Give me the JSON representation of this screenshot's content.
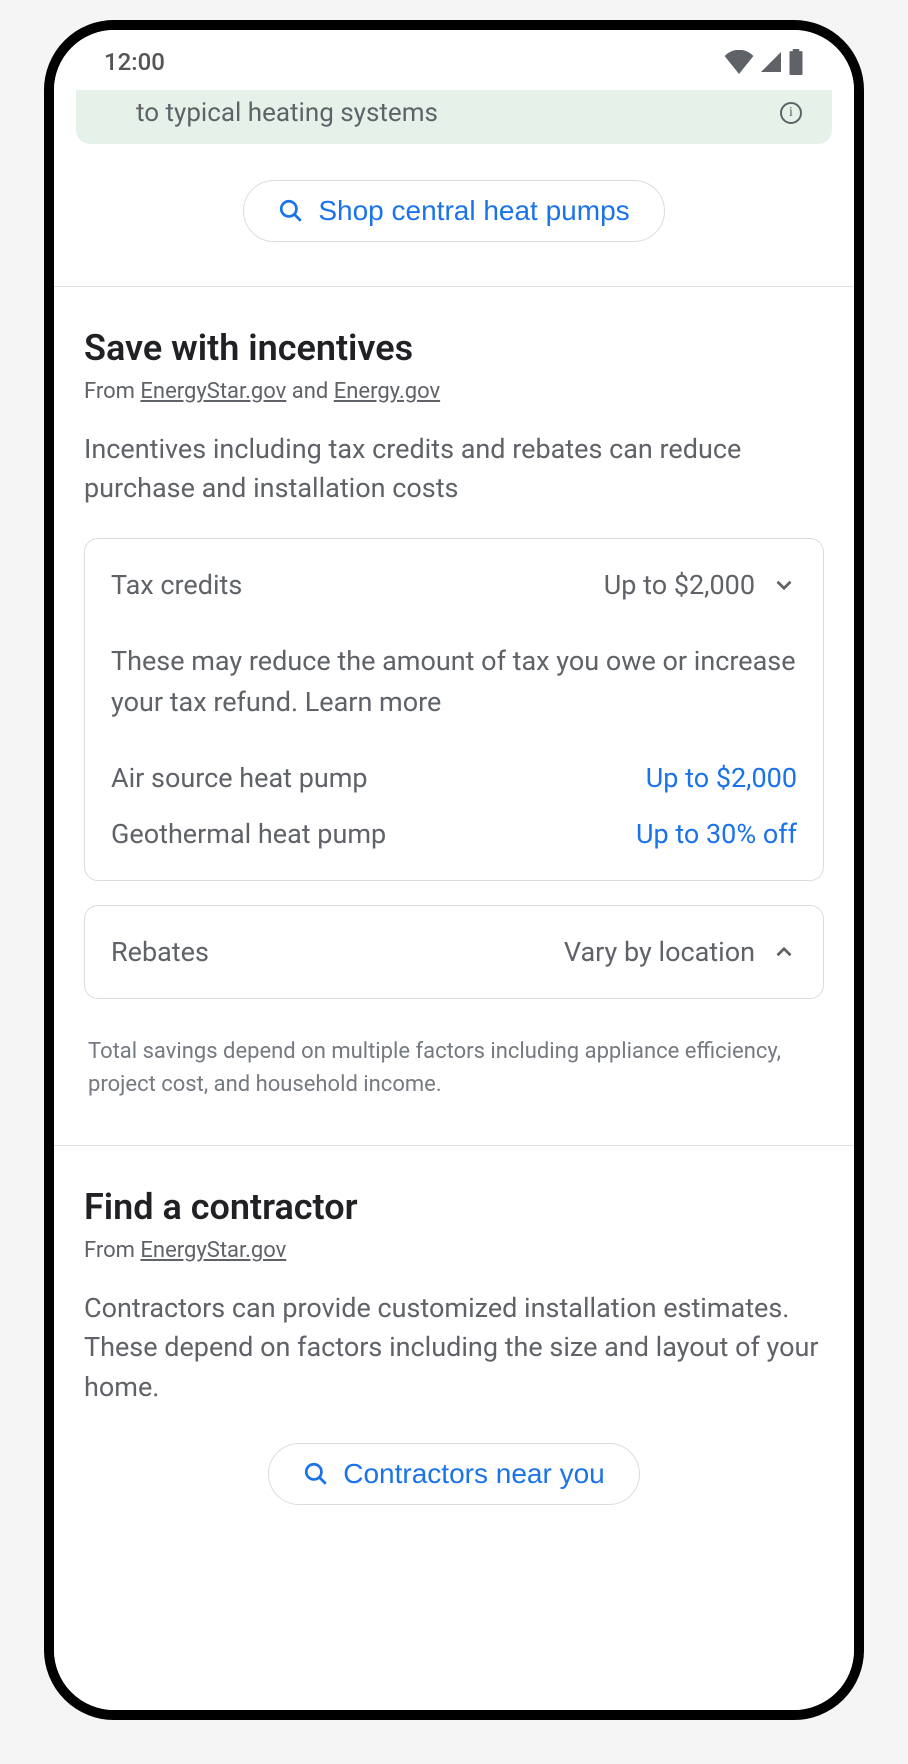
{
  "status": {
    "time": "12:00"
  },
  "banner": {
    "text": "to typical heating systems"
  },
  "shop_button": {
    "label": "Shop central heat pumps"
  },
  "incentives": {
    "heading": "Save with incentives",
    "from_prefix": "From ",
    "source1": "EnergyStar.gov",
    "and": " and ",
    "source2": "Energy.gov",
    "description": "Incentives including tax credits and rebates can reduce purchase and installation costs",
    "tax_credits": {
      "label": "Tax credits",
      "value": "Up to $2,000",
      "explain": "These may reduce the amount of tax you owe or increase your tax refund. Learn more",
      "items": [
        {
          "label": "Air source heat pump",
          "value": "Up to $2,000"
        },
        {
          "label": "Geothermal heat pump",
          "value": "Up to 30% off"
        }
      ]
    },
    "rebates": {
      "label": "Rebates",
      "value": "Vary by location"
    },
    "footnote": "Total savings depend on multiple factors including appliance efficiency, project cost, and household income."
  },
  "contractor": {
    "heading": "Find a contractor",
    "from_prefix": "From ",
    "source": "EnergyStar.gov",
    "description": "Contractors can provide customized installation estimates. These depend on factors including the size and layout of your home.",
    "button_label": "Contractors near you"
  }
}
